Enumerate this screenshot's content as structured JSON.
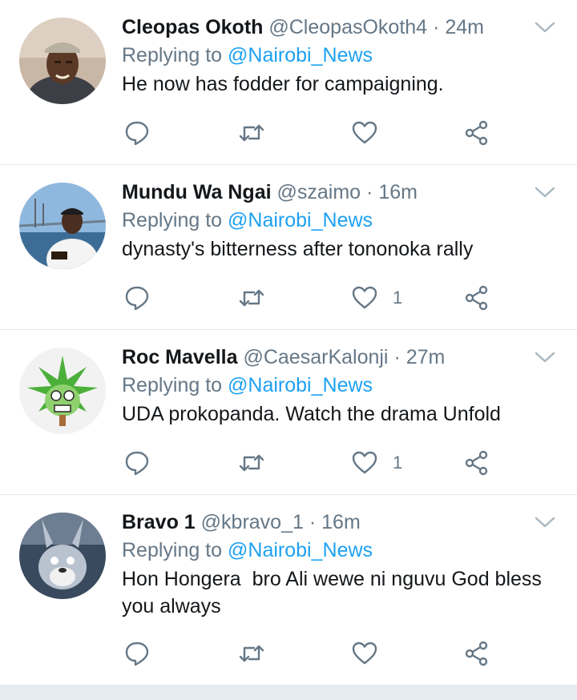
{
  "tweets": [
    {
      "name": "Cleopas Okoth",
      "handle": "@CleopasOkoth4",
      "dot": "·",
      "time": "24m",
      "replying_prefix": "Replying to ",
      "replying_to": "@Nairobi_News",
      "text": "He now has fodder for campaigning.",
      "like_count": ""
    },
    {
      "name": "Mundu Wa Ngai",
      "handle": "@szaimo",
      "dot": "·",
      "time": "16m",
      "replying_prefix": "Replying to ",
      "replying_to": "@Nairobi_News",
      "text": "dynasty's bitterness after tononoka rally",
      "like_count": "1"
    },
    {
      "name": "Roc Mavella",
      "handle": "@CaesarKalonji",
      "dot": "·",
      "time": "27m",
      "replying_prefix": "Replying to ",
      "replying_to": "@Nairobi_News",
      "text": "UDA prokopanda. Watch the drama Unfold",
      "like_count": "1"
    },
    {
      "name": "Bravo 1",
      "handle": "@kbravo_1",
      "dot": "·",
      "time": "16m",
      "replying_prefix": "Replying to ",
      "replying_to": "@Nairobi_News",
      "text": "Hon Hongera  bro Ali wewe ni nguvu God bless you always",
      "like_count": ""
    }
  ],
  "icons": {
    "reply": "reply-icon",
    "retweet": "retweet-icon",
    "like": "heart-icon",
    "share": "share-icon",
    "menu": "chevron-down-icon"
  },
  "colors": {
    "link": "#1da1f2",
    "muted": "#657786",
    "text": "#14171a",
    "divider": "#e1e8ed"
  }
}
